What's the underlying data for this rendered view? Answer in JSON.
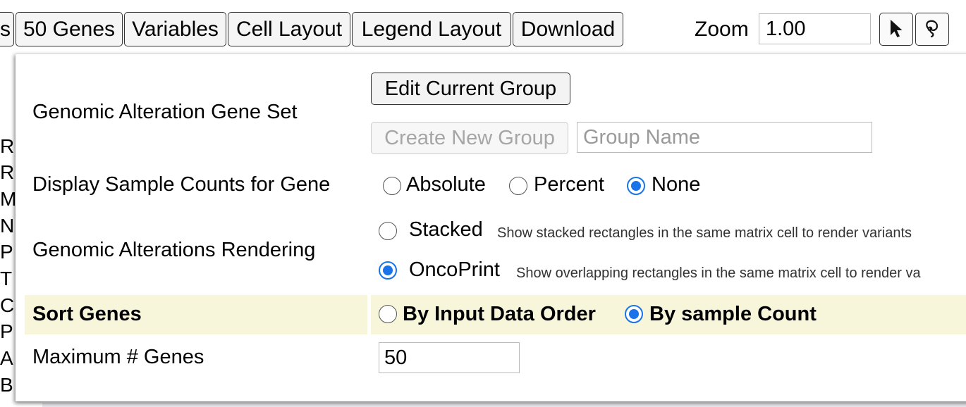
{
  "toolbar": {
    "buttons": [
      {
        "label": "s"
      },
      {
        "label": "50 Genes"
      },
      {
        "label": "Variables"
      },
      {
        "label": "Cell Layout"
      },
      {
        "label": "Legend Layout"
      },
      {
        "label": "Download"
      }
    ],
    "zoom_label": "Zoom",
    "zoom_value": "1.00",
    "tools": [
      {
        "icon": "select-arrow-icon"
      },
      {
        "icon": "lasso-icon"
      }
    ]
  },
  "background_genes": [
    "R",
    "R",
    "M",
    "N",
    "P",
    "T",
    "C",
    "P",
    "A",
    "B"
  ],
  "panel": {
    "gene_set": {
      "label": "Genomic Alteration Gene Set",
      "edit_button": "Edit Current Group",
      "create_button": "Create New Group",
      "group_name_placeholder": "Group Name"
    },
    "sample_counts": {
      "label": "Display Sample Counts for Gene",
      "options": [
        "Absolute",
        "Percent",
        "None"
      ],
      "selected": "None"
    },
    "rendering": {
      "label": "Genomic Alterations Rendering",
      "options": [
        {
          "label": "Stacked",
          "description": "Show stacked rectangles in the same matrix cell to render variants"
        },
        {
          "label": "OncoPrint",
          "description": "Show overlapping rectangles in the same matrix cell to render va"
        }
      ],
      "selected": "OncoPrint"
    },
    "sort_genes": {
      "label": "Sort Genes",
      "options": [
        "By Input Data Order",
        "By sample Count"
      ],
      "selected": "By sample Count"
    },
    "max_genes": {
      "label": "Maximum # Genes",
      "value": "50"
    }
  },
  "colors": {
    "highlight_row": "#f8f6da",
    "radio_accent": "#1a73e8",
    "disabled_text": "#a6a6a6"
  }
}
